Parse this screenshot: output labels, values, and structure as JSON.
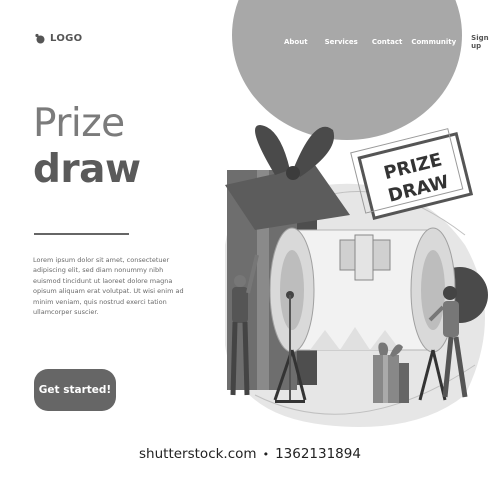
{
  "header": {
    "logo_text": "LOGO",
    "nav": {
      "about": "About",
      "services": "Services",
      "contact": "Contact",
      "community": "Community",
      "signup": "Sign up"
    }
  },
  "hero": {
    "title_line1": "Prize",
    "title_line2": "draw",
    "body": "Lorem ipsum dolor sit amet, consectetuer adipiscing elit, sed diam nonummy nibh euismod tincidunt ut laoreet dolore magna opisum aliquam erat volutpat. Ut wisi enim ad minim veniam, quis nostrud exerci tation ullamcorper suscier.",
    "cta_label": "Get started!"
  },
  "illustration": {
    "ticket_line1": "PRIZE",
    "ticket_line2": "DRAW"
  },
  "watermark": {
    "site": "shutterstock.com",
    "separator": "•",
    "id": "1362131894"
  },
  "colors": {
    "blob": "#a8a8a8",
    "cta": "#666666",
    "heading_bold": "#5a5a5a",
    "heading_light": "#7b7b7b"
  }
}
